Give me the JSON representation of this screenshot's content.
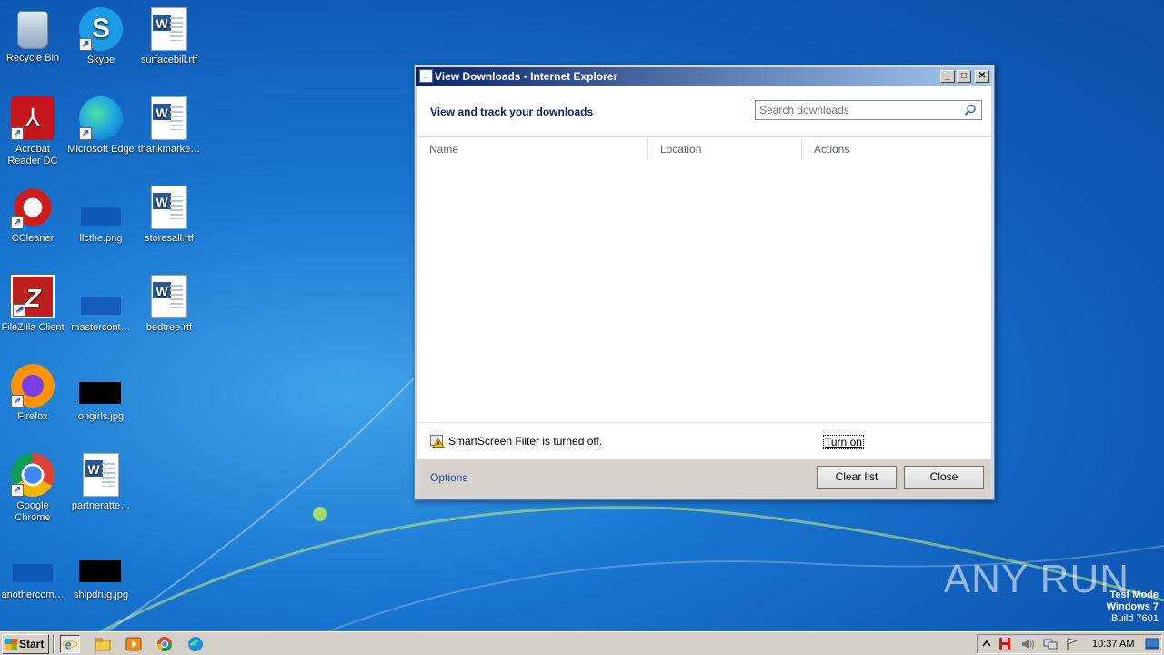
{
  "desktop": {
    "icons": [
      {
        "label": "Recycle Bin",
        "icon": "recycle-bin-icon"
      },
      {
        "label": "Skype",
        "icon": "skype-icon",
        "glyph": "S"
      },
      {
        "label": "surfacebill.rtf",
        "icon": "word-document-icon",
        "glyph": "W"
      },
      {
        "label": "Acrobat Reader DC",
        "icon": "acrobat-reader-icon",
        "glyph": "⅄"
      },
      {
        "label": "Microsoft Edge",
        "icon": "edge-icon"
      },
      {
        "label": "thankmarke…",
        "icon": "word-document-icon",
        "glyph": "W"
      },
      {
        "label": "CCleaner",
        "icon": "ccleaner-icon"
      },
      {
        "label": "llcthe.png",
        "icon": "image-file-icon"
      },
      {
        "label": "storesall.rtf",
        "icon": "word-document-icon",
        "glyph": "W"
      },
      {
        "label": "FileZilla Client",
        "icon": "filezilla-icon",
        "glyph": "Z"
      },
      {
        "label": "mastercont…",
        "icon": "image-file-icon"
      },
      {
        "label": "bedtree.rtf",
        "icon": "word-document-icon",
        "glyph": "W"
      },
      {
        "label": "Firefox",
        "icon": "firefox-icon"
      },
      {
        "label": "ongirls.jpg",
        "icon": "image-file-icon"
      },
      {
        "label": "Google Chrome",
        "icon": "chrome-icon"
      },
      {
        "label": "partneratte…",
        "icon": "word-document-icon",
        "glyph": "W"
      },
      {
        "label": "anothercom…",
        "icon": "image-file-icon"
      },
      {
        "label": "shipdrug.jpg",
        "icon": "image-file-icon"
      }
    ],
    "watermark": "ANY RUN",
    "test_mode": {
      "line1": "Test Mode",
      "line2": "Windows 7",
      "line3": "Build 7601"
    }
  },
  "window": {
    "title": "View Downloads - Internet Explorer",
    "controls": {
      "minimize": "_",
      "maximize": "□",
      "close": "✕"
    },
    "header": "View and track your downloads",
    "search_placeholder": "Search downloads",
    "columns": [
      "Name",
      "Location",
      "Actions"
    ],
    "smartscreen_text": "SmartScreen Filter is turned off.",
    "turn_on_label": "Turn on",
    "options_label": "Options",
    "clear_list_label": "Clear list",
    "close_label": "Close"
  },
  "taskbar": {
    "start_label": "Start",
    "clock": "10:37 AM",
    "pinned": [
      "internet-explorer-icon",
      "file-explorer-icon",
      "media-player-icon",
      "chrome-icon",
      "edge-icon"
    ],
    "tray_icons": [
      "show-hidden-icons-icon",
      "security-app-icon",
      "volume-icon",
      "network-icon",
      "action-center-flag-icon",
      "show-desktop-icon"
    ],
    "colors": {
      "accent": "#0a246a",
      "tray_red": "#d11a1a"
    }
  }
}
